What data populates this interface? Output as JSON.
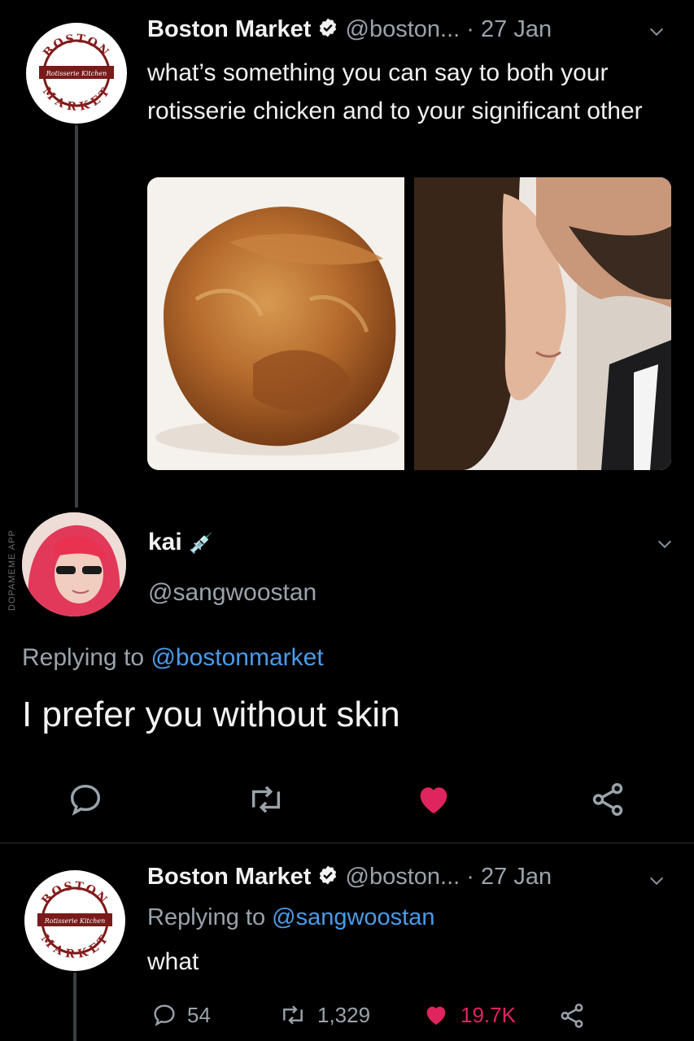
{
  "tweet1": {
    "name": "Boston Market",
    "handle": "@boston...",
    "date": "· 27 Jan",
    "text": "what’s something you can say to both your rotisserie chicken and to your significant other",
    "logo": {
      "top": "BOSTON",
      "middle": "Rotisserie Kitchen",
      "bottom": "MARKET"
    },
    "images": [
      "roast-chicken-photo",
      "couple-photo"
    ]
  },
  "reply1": {
    "name": "kai",
    "emoji": "💉",
    "handle": "@sangwoostan",
    "replying_prefix": "Replying to",
    "replying_to": "@bostonmarket",
    "text": "I prefer you without skin"
  },
  "tweet2": {
    "name": "Boston Market",
    "handle": "@boston...",
    "date": "· 27 Jan",
    "replying_prefix": "Replying to",
    "replying_to": "@sangwoostan",
    "text": "what",
    "logo": {
      "top": "BOSTON",
      "middle": "Rotisserie Kitchen",
      "bottom": "MARKET"
    },
    "stats": {
      "replies": "54",
      "retweets": "1,329",
      "likes": "19.7K"
    }
  },
  "watermark": "DOPAMEME APP",
  "colors": {
    "background": "#000000",
    "link": "#4a9be8",
    "like": "#e0245e",
    "muted": "#9aa3ab"
  }
}
